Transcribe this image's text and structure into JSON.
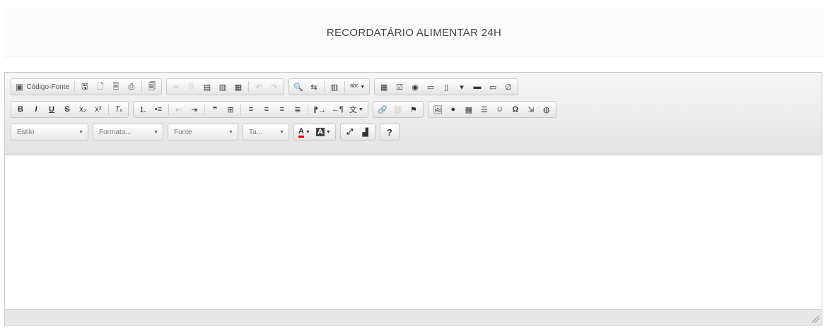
{
  "page": {
    "title": "RECORDATÁRIO ALIMENTAR 24H"
  },
  "toolbar": {
    "source_label": "Código-Fonte",
    "style_combo": "Estilo",
    "format_combo": "Formata...",
    "font_combo": "Fonte",
    "size_combo": "Ta...",
    "help_label": "?"
  },
  "icons": {
    "source": "▣",
    "save": "🖫",
    "new_page": "🗋",
    "preview": "🗎",
    "print": "⎙",
    "templates": "🗐",
    "cut": "✂",
    "copy": "⎘",
    "paste": "▤",
    "paste_text": "▥",
    "paste_word": "▦",
    "undo": "↶",
    "redo": "↷",
    "find": "🔍",
    "replace": "⇆",
    "select_all": "▥",
    "spellcheck": "ᵃᵇᶜ",
    "form": "▦",
    "checkbox": "☑",
    "radio": "◉",
    "textfield": "▭",
    "textarea": "▯",
    "select": "▾",
    "button": "▬",
    "imagebutton": "▭",
    "hiddenfield": "∅",
    "bold": "B",
    "italic": "I",
    "underline": "U",
    "strike": "S",
    "subscript": "x₂",
    "superscript": "x²",
    "remove_format": "Tₓ",
    "numbered_list": "⒈",
    "bulleted_list": "•≡",
    "outdent": "⇤",
    "indent": "⇥",
    "blockquote": "❞",
    "div": "⊞",
    "align_left": "≡",
    "align_center": "≡",
    "align_right": "≡",
    "justify": "≣",
    "ltr": "⁋→",
    "rtl": "←¶",
    "language": "文",
    "link": "🔗",
    "unlink": "⛓",
    "anchor": "⚑",
    "image": "🖼",
    "flash": "●",
    "table": "▦",
    "hr": "☰",
    "smiley": "☺",
    "special_char": "Ω",
    "page_break": "⇲",
    "iframe": "◍",
    "text_color": "A",
    "bg_color": "A",
    "maximize": "⤢",
    "show_blocks": "▟",
    "arrow": "▼"
  }
}
